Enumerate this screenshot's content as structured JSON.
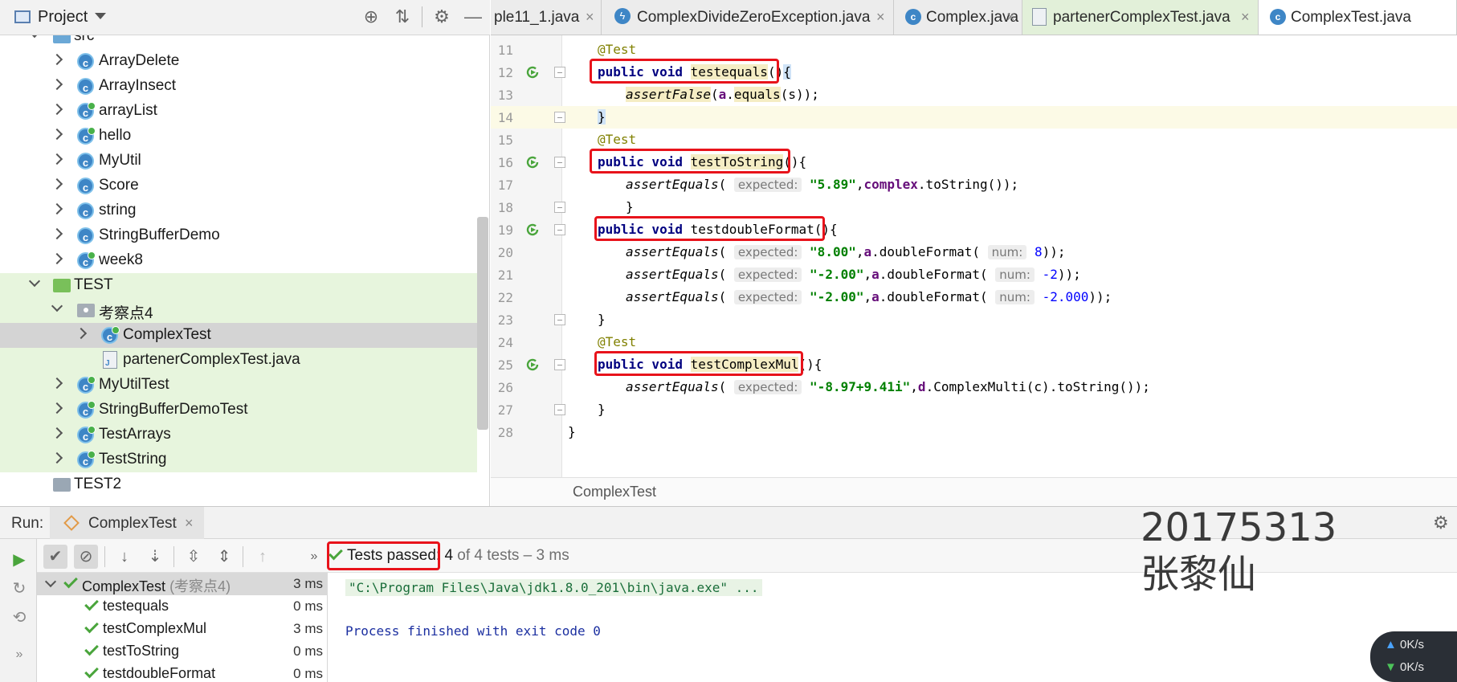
{
  "project_panel": {
    "title": "Project",
    "tree": [
      {
        "label": "src",
        "kind": "folder-src",
        "expanded": true,
        "depth": 1
      },
      {
        "label": "ArrayDelete",
        "kind": "class",
        "depth": 2
      },
      {
        "label": "ArrayInsect",
        "kind": "class",
        "depth": 2
      },
      {
        "label": "arrayList",
        "kind": "class-test",
        "depth": 2
      },
      {
        "label": "hello",
        "kind": "class-test",
        "depth": 2
      },
      {
        "label": "MyUtil",
        "kind": "class",
        "depth": 2
      },
      {
        "label": "Score",
        "kind": "class",
        "depth": 2
      },
      {
        "label": "string",
        "kind": "class",
        "depth": 2
      },
      {
        "label": "StringBufferDemo",
        "kind": "class",
        "depth": 2
      },
      {
        "label": "week8",
        "kind": "class-test",
        "depth": 2
      },
      {
        "label": "TEST",
        "kind": "folder-test",
        "expanded": true,
        "depth": 1
      },
      {
        "label": "考察点4",
        "kind": "package",
        "expanded": true,
        "depth": 2
      },
      {
        "label": "ComplexTest",
        "kind": "class-test",
        "depth": 3,
        "selected": true
      },
      {
        "label": "partenerComplexTest.java",
        "kind": "file",
        "depth": 3
      },
      {
        "label": "MyUtilTest",
        "kind": "class-test",
        "depth": 2
      },
      {
        "label": "StringBufferDemoTest",
        "kind": "class-test",
        "depth": 2
      },
      {
        "label": "TestArrays",
        "kind": "class-test",
        "depth": 2
      },
      {
        "label": "TestString",
        "kind": "class-test",
        "depth": 2
      },
      {
        "label": "TEST2",
        "kind": "folder",
        "depth": 1
      }
    ]
  },
  "editor": {
    "tabs": [
      {
        "label": "ple11_1.java",
        "icon": "none"
      },
      {
        "label": "ComplexDivideZeroException.java",
        "icon": "exception-icon"
      },
      {
        "label": "Complex.java",
        "icon": "class-icon"
      },
      {
        "label": "partenerComplexTest.java",
        "icon": "file-icon"
      },
      {
        "label": "ComplexTest.java",
        "icon": "class-icon"
      }
    ],
    "line_numbers": [
      "11",
      "12",
      "13",
      "14",
      "15",
      "16",
      "17",
      "18",
      "19",
      "20",
      "21",
      "22",
      "23",
      "24",
      "25",
      "26",
      "27",
      "28"
    ],
    "code": {
      "l11_ann": "@Test",
      "l12_kw": "public void",
      "l12_name": "testequals",
      "l12_paren": "()",
      "l12_brace": "{",
      "l13_fn": "assertFalse",
      "l13_rest1": "(",
      "l13_obj": "a",
      "l13_dot": ".",
      "l13_method": "equals",
      "l13_rest2": "(s));",
      "l14": "}",
      "l15_ann": "@Test",
      "l16_kw": "public void",
      "l16_name": "testToString",
      "l16_paren": "()",
      "l16_brace": "{",
      "l17_fn": "assertEquals",
      "l17_open": "(",
      "l17_hint": "expected:",
      "l17_str": "\"5.89\"",
      "l17_comma": ",",
      "l17_obj": "complex",
      "l17_rest": ".toString());",
      "l18": "}",
      "l19_kw": "public void",
      "l19_name": "testdoubleFormat",
      "l19_paren": "()",
      "l19_brace": "{",
      "l20_fn": "assertEquals",
      "l20_open": "(",
      "l20_hint": "expected:",
      "l20_str": "\"8.00\"",
      "l20_comma": ",",
      "l20_obj": "a",
      "l20_method": ".doubleFormat(",
      "l20_hint2": "num:",
      "l20_num": "8",
      "l20_end": "));",
      "l21_fn": "assertEquals",
      "l21_open": "(",
      "l21_hint": "expected:",
      "l21_str": "\"-2.00\"",
      "l21_comma": ",",
      "l21_obj": "a",
      "l21_method": ".doubleFormat(",
      "l21_hint2": "num:",
      "l21_num": "-2",
      "l21_end": "));",
      "l22_fn": "assertEquals",
      "l22_open": "(",
      "l22_hint": "expected:",
      "l22_str": "\"-2.00\"",
      "l22_comma": ",",
      "l22_obj": "a",
      "l22_method": ".doubleFormat(",
      "l22_hint2": "num:",
      "l22_num": "-2.000",
      "l22_end": "));",
      "l23": "}",
      "l24_ann": "@Test",
      "l25_kw": "public void",
      "l25_name": "testComplexMul",
      "l25_paren": "()",
      "l25_brace": "{",
      "l26_fn": "assertEquals",
      "l26_open": "(",
      "l26_hint": "expected:",
      "l26_str": "\"-8.97+9.41i\"",
      "l26_comma": ",",
      "l26_obj": "d",
      "l26_rest": ".ComplexMulti(c).toString());",
      "l27": "}",
      "l28": "}"
    },
    "breadcrumb": "ComplexTest"
  },
  "run_panel": {
    "label": "Run:",
    "tab_label": "ComplexTest",
    "status_passed": "Tests passed: 4",
    "status_rest": " of 4 tests – 3 ms",
    "tests": [
      {
        "name": "ComplexTest",
        "sub": "(考察点4)",
        "time": "3 ms",
        "root": true
      },
      {
        "name": "testequals",
        "time": "0 ms"
      },
      {
        "name": "testComplexMul",
        "time": "3 ms"
      },
      {
        "name": "testToString",
        "time": "0 ms"
      },
      {
        "name": "testdoubleFormat",
        "time": "0 ms"
      }
    ],
    "console_cmd": "\"C:\\Program Files\\Java\\jdk1.8.0_201\\bin\\java.exe\" ...",
    "console_exit": "Process finished with exit code 0"
  },
  "watermark": {
    "line1": "20175313",
    "line2": "张黎仙"
  },
  "net_meter": {
    "up": "0K/s",
    "down": "0K/s"
  },
  "colors": {
    "highlight_red": "#e8131b",
    "pass_green": "#4aa53c",
    "test_tint": "#e7f5dd"
  }
}
